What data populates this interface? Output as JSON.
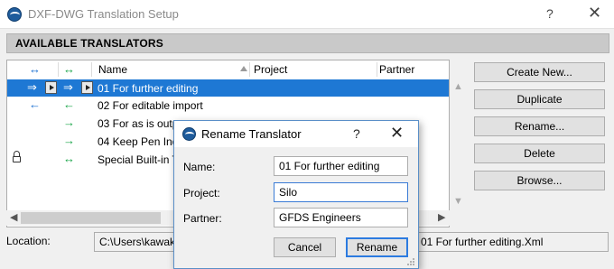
{
  "window": {
    "title": "DXF-DWG Translation Setup",
    "help": "?",
    "close": "✕"
  },
  "section": {
    "title": "AVAILABLE TRANSLATORS"
  },
  "list": {
    "headers": {
      "col1": "↔",
      "col2": "↔",
      "name": "Name",
      "project": "Project",
      "partner": "Partner"
    },
    "rows": [
      {
        "col1": "⇒",
        "col2": "⇒",
        "name": "01 For further editing",
        "selected": true
      },
      {
        "col1": "←",
        "col2": "←",
        "name": "02 For editable import"
      },
      {
        "col1": "",
        "col2": "→",
        "name": "03 For as is output"
      },
      {
        "col1": "",
        "col2": "→",
        "name": "04 Keep Pen Index"
      },
      {
        "col1": "",
        "col2": "↔",
        "name": "Special Built-in Translator"
      }
    ],
    "scroll": {
      "left": "◀",
      "right": "▶",
      "up": "▲",
      "down": "▼"
    }
  },
  "buttons": {
    "create_new": "Create New...",
    "duplicate": "Duplicate",
    "rename": "Rename...",
    "delete": "Delete",
    "browse": "Browse..."
  },
  "location": {
    "label": "Location:",
    "path_start": "C:\\Users\\kawaku",
    "path_end": "01 For further editing.Xml"
  },
  "dialog": {
    "title": "Rename Translator",
    "help": "?",
    "close": "✕",
    "name_label": "Name:",
    "name_value": "01 For further editing",
    "project_label": "Project:",
    "project_value": "Silo",
    "partner_label": "Partner:",
    "partner_value": "GFDS Engineers",
    "cancel": "Cancel",
    "confirm": "Rename"
  },
  "colors": {
    "selection": "#1e78d4",
    "accent_blue": "#1a6fd1",
    "accent_green": "#1aa548"
  },
  "icons": [
    "app-logo-icon",
    "lock-icon",
    "play-icon",
    "close-icon",
    "help-icon",
    "sort-arrow-icon",
    "resize-grip-icon"
  ]
}
